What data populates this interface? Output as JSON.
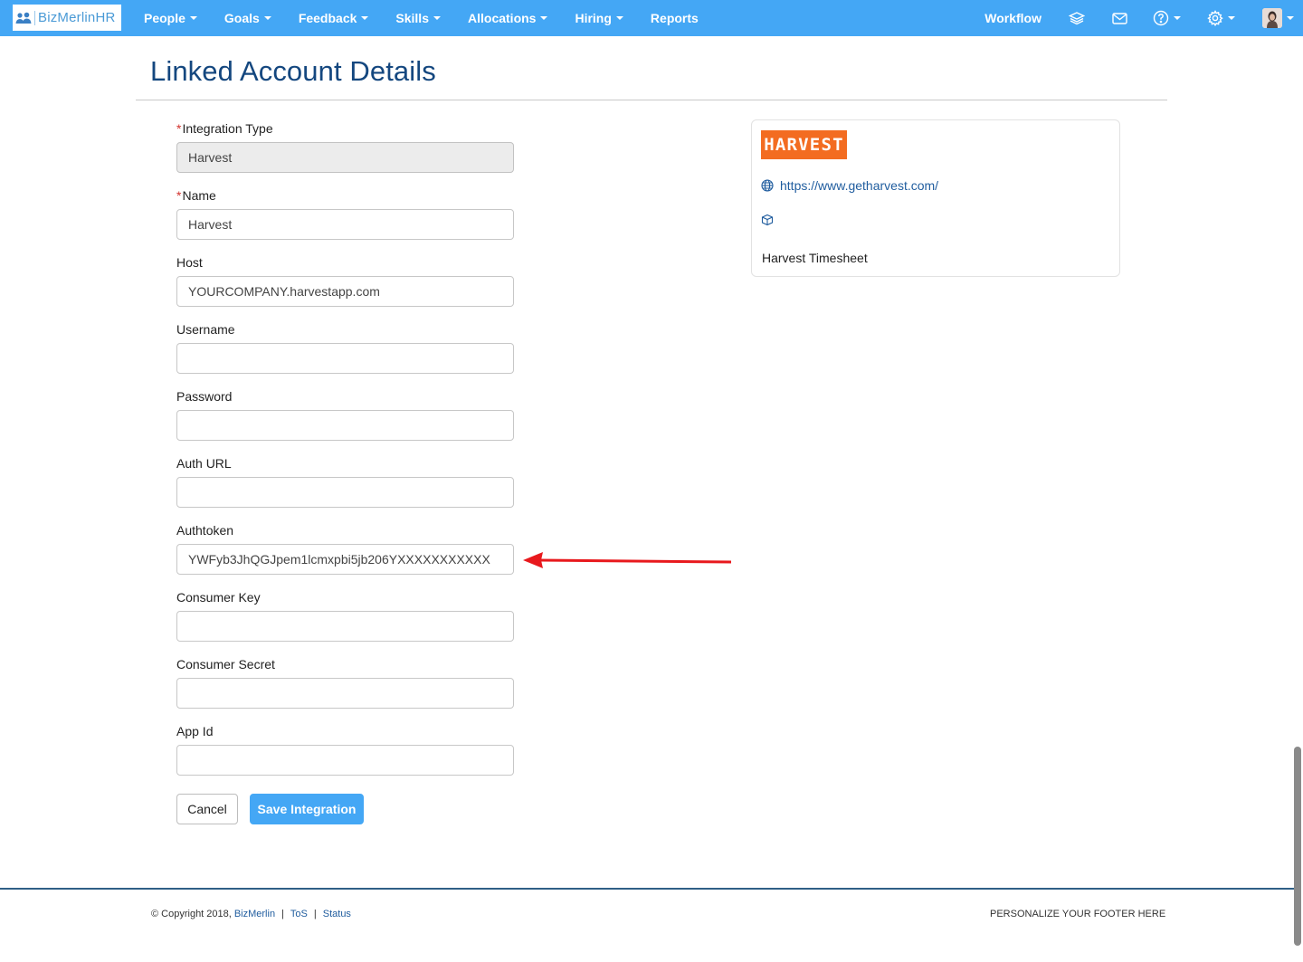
{
  "navbar": {
    "logo_text": "BizMerlinHR",
    "menu": [
      {
        "label": "People"
      },
      {
        "label": "Goals"
      },
      {
        "label": "Feedback"
      },
      {
        "label": "Skills"
      },
      {
        "label": "Allocations"
      },
      {
        "label": "Hiring"
      },
      {
        "label": "Reports"
      }
    ],
    "workflow_label": "Workflow"
  },
  "page": {
    "title": "Linked Account Details"
  },
  "form": {
    "integration_type": {
      "label": "Integration Type",
      "value": "Harvest",
      "required": true
    },
    "name": {
      "label": "Name",
      "value": "Harvest",
      "required": true
    },
    "host": {
      "label": "Host",
      "value": "YOURCOMPANY.harvestapp.com"
    },
    "username": {
      "label": "Username",
      "value": ""
    },
    "password": {
      "label": "Password",
      "value": ""
    },
    "auth_url": {
      "label": "Auth URL",
      "value": ""
    },
    "authtoken": {
      "label": "Authtoken",
      "value": "YWFyb3JhQGJpem1lcmxpbi5jb206YXXXXXXXXXXX"
    },
    "consumer_key": {
      "label": "Consumer Key",
      "value": ""
    },
    "consumer_secret": {
      "label": "Consumer Secret",
      "value": ""
    },
    "app_id": {
      "label": "App Id",
      "value": ""
    },
    "required_mark": "*",
    "cancel_label": "Cancel",
    "save_label": "Save Integration"
  },
  "card": {
    "logo_text": "HARVEST",
    "url": "https://www.getharvest.com/",
    "description": "Harvest Timesheet"
  },
  "footer": {
    "copyright": "© Copyright 2018,",
    "company_link": "BizMerlin",
    "separator": "|",
    "tos_link": "ToS",
    "status_link": "Status",
    "right_text": "PERSONALIZE YOUR FOOTER HERE"
  },
  "colors": {
    "navbar": "#44a7f5",
    "title": "#14477f",
    "link": "#1f5c9e",
    "harvest_brand": "#f36c21",
    "annotation_arrow": "#e8191d",
    "required": "#d2322d"
  }
}
